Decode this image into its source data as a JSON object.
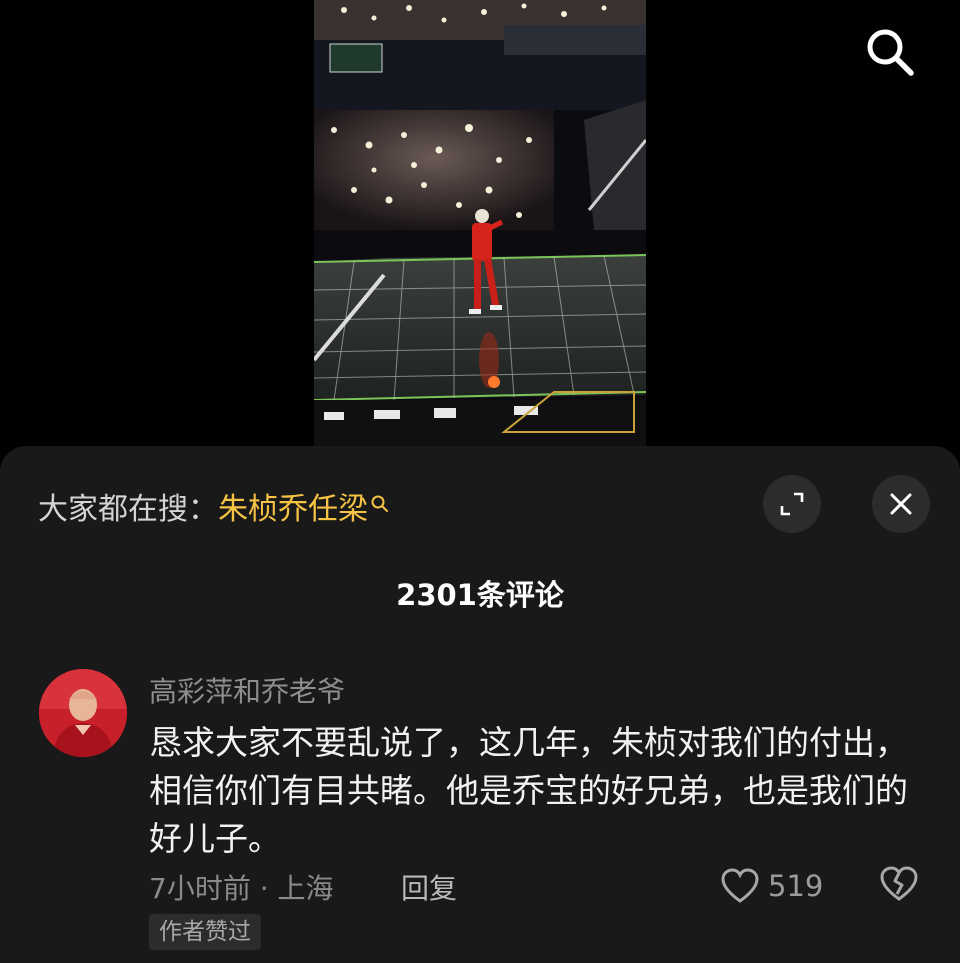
{
  "video": {
    "search_icon": "search-icon"
  },
  "sheet": {
    "trending_label": "大家都在搜：",
    "trending_term": "朱桢乔任梁",
    "trending_icon": "search-icon",
    "expand_icon": "expand-icon",
    "close_icon": "close-icon",
    "comment_count": "2301条评论"
  },
  "comment": {
    "username": "高彩萍和乔老爷",
    "text": "恳求大家不要乱说了，这几年，朱桢对我们的付出，相信你们有目共睹。他是乔宝的好兄弟，也是我们的好儿子。",
    "time_location": "7小时前 · 上海",
    "reply_label": "回复",
    "like_count": "519",
    "author_liked_badge": "作者赞过",
    "like_icon": "heart-icon",
    "dislike_icon": "broken-heart-icon"
  },
  "colors": {
    "sheet_bg": "#191919",
    "trending_accent": "#f6c344",
    "performer_outfit": "#d6241c",
    "stage_grid": "#7cc35a"
  }
}
